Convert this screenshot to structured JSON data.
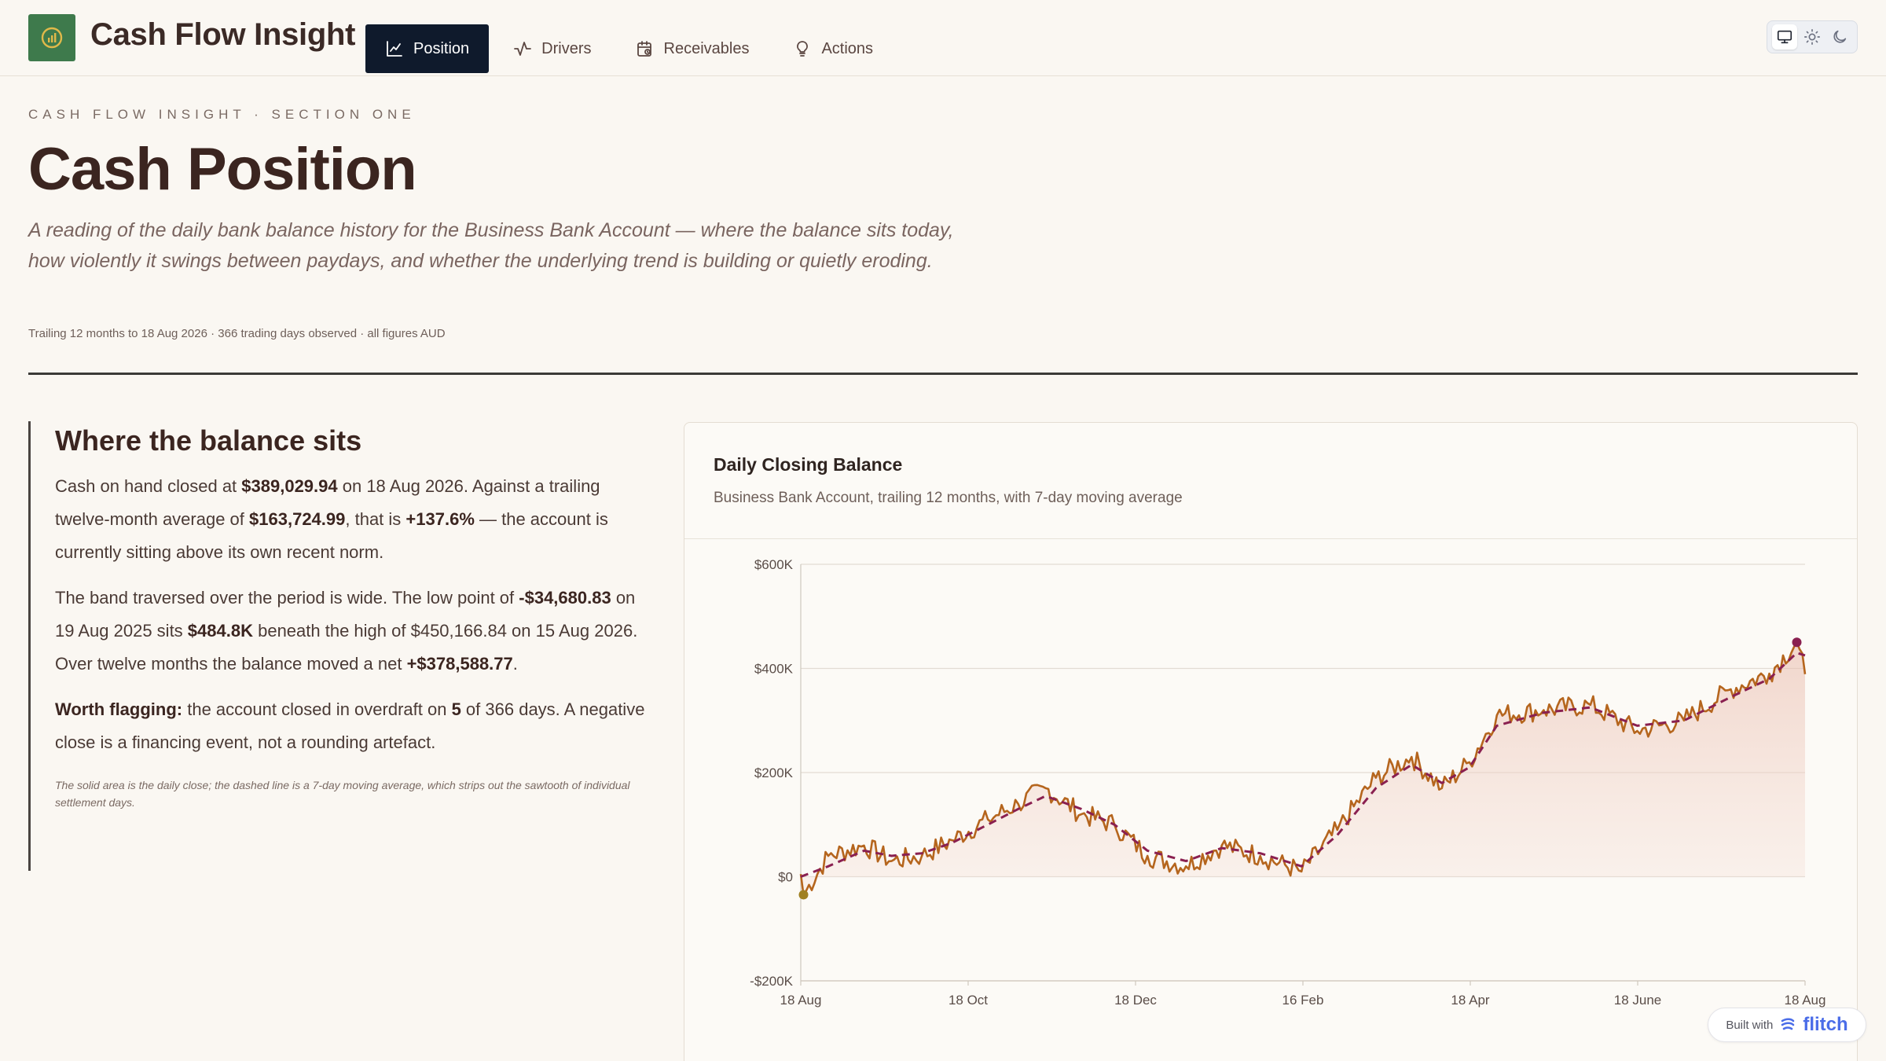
{
  "app": {
    "title": "Cash Flow Insight"
  },
  "nav": [
    {
      "label": "Position",
      "icon": "line-chart-icon",
      "active": true
    },
    {
      "label": "Drivers",
      "icon": "activity-icon",
      "active": false
    },
    {
      "label": "Receivables",
      "icon": "calendar-clock-icon",
      "active": false
    },
    {
      "label": "Actions",
      "icon": "lightbulb-icon",
      "active": false
    }
  ],
  "theme": {
    "options": [
      "monitor-icon",
      "sun-icon",
      "moon-icon"
    ],
    "selected": "monitor-icon"
  },
  "header": {
    "eyebrow": "CASH FLOW INSIGHT · SECTION ONE",
    "title": "Cash Position",
    "lede": "A reading of the daily bank balance history for the Business Bank Account — where the balance sits today, how violently it swings between paydays, and whether the underlying trend is building or quietly eroding.",
    "meta": "Trailing 12 months to 18 Aug 2026 · 366 trading days observed · all figures AUD"
  },
  "narrative": {
    "title": "Where the balance sits",
    "p1": {
      "a": "Cash on hand closed at ",
      "closing": "$389,029.94",
      "b": " on 18 Aug 2026. Against a trailing twelve-month average of ",
      "average": "$163,724.99",
      "c": ", that is ",
      "pct": "+137.6%",
      "d": " — the account is currently sitting above its own recent norm."
    },
    "p2": {
      "a": "The band traversed over the period is wide. The low point of ",
      "low": "-$34,680.83",
      "b": " on 19 Aug 2025 sits ",
      "gap": "$484.8K",
      "c": " beneath the high of $450,166.84 on 15 Aug 2026. Over twelve months the balance moved a net ",
      "net": "+$378,588.77",
      "d": "."
    },
    "p3": {
      "flag": "Worth flagging:",
      "a": " the account closed in overdraft on ",
      "days": "5",
      "b": " of 366 days. A negative close is a financing event, not a rounding artefact."
    },
    "note": "The solid area is the daily close; the dashed line is a 7-day moving average, which strips out the sawtooth of individual settlement days."
  },
  "chart_card": {
    "title": "Daily Closing Balance",
    "subtitle": "Business Bank Account, trailing 12 months, with 7-day moving average"
  },
  "chart_data": {
    "type": "area",
    "title": "Daily Closing Balance",
    "xlabel": "",
    "ylabel": "",
    "x_ticks": [
      "18 Aug",
      "18 Oct",
      "18 Dec",
      "16 Feb",
      "18 Apr",
      "18 June",
      "18 Aug"
    ],
    "y_ticks": [
      "$600K",
      "$400K",
      "$200K",
      "$0",
      "-$200K"
    ],
    "ylim": [
      -200000,
      600000
    ],
    "grid": true,
    "series": [
      {
        "style": "solid-area",
        "color": "#b5651d",
        "points": [
          {
            "x": "2025-08-18",
            "y": 5000
          },
          {
            "x": "2025-08-19",
            "y": -34681
          },
          {
            "x": "2025-08-28",
            "y": 40000
          },
          {
            "x": "2025-09-10",
            "y": 60000
          },
          {
            "x": "2025-09-20",
            "y": 30000
          },
          {
            "x": "2025-10-01",
            "y": 40000
          },
          {
            "x": "2025-10-12",
            "y": 70000
          },
          {
            "x": "2025-10-25",
            "y": 110000
          },
          {
            "x": "2025-11-05",
            "y": 140000
          },
          {
            "x": "2025-11-15",
            "y": 170000
          },
          {
            "x": "2025-11-28",
            "y": 120000
          },
          {
            "x": "2025-12-10",
            "y": 100000
          },
          {
            "x": "2025-12-22",
            "y": 40000
          },
          {
            "x": "2026-01-05",
            "y": 20000
          },
          {
            "x": "2026-01-18",
            "y": 60000
          },
          {
            "x": "2026-02-01",
            "y": 40000
          },
          {
            "x": "2026-02-16",
            "y": 10000
          },
          {
            "x": "2026-03-01",
            "y": 90000
          },
          {
            "x": "2026-03-15",
            "y": 190000
          },
          {
            "x": "2026-03-28",
            "y": 230000
          },
          {
            "x": "2026-04-08",
            "y": 170000
          },
          {
            "x": "2026-04-18",
            "y": 220000
          },
          {
            "x": "2026-04-28",
            "y": 310000
          },
          {
            "x": "2026-05-15",
            "y": 320000
          },
          {
            "x": "2026-06-01",
            "y": 330000
          },
          {
            "x": "2026-06-18",
            "y": 280000
          },
          {
            "x": "2026-07-05",
            "y": 300000
          },
          {
            "x": "2026-07-22",
            "y": 360000
          },
          {
            "x": "2026-08-05",
            "y": 390000
          },
          {
            "x": "2026-08-15",
            "y": 450167
          },
          {
            "x": "2026-08-18",
            "y": 389030
          }
        ]
      },
      {
        "style": "dashed-line",
        "color": "#8a2050",
        "points": [
          {
            "x": "2025-08-18",
            "y": 0
          },
          {
            "x": "2025-08-28",
            "y": 20000
          },
          {
            "x": "2025-09-10",
            "y": 50000
          },
          {
            "x": "2025-09-20",
            "y": 40000
          },
          {
            "x": "2025-10-01",
            "y": 45000
          },
          {
            "x": "2025-10-12",
            "y": 65000
          },
          {
            "x": "2025-10-25",
            "y": 100000
          },
          {
            "x": "2025-11-05",
            "y": 130000
          },
          {
            "x": "2025-11-15",
            "y": 155000
          },
          {
            "x": "2025-11-28",
            "y": 130000
          },
          {
            "x": "2025-12-10",
            "y": 100000
          },
          {
            "x": "2025-12-22",
            "y": 50000
          },
          {
            "x": "2026-01-05",
            "y": 30000
          },
          {
            "x": "2026-01-18",
            "y": 55000
          },
          {
            "x": "2026-02-01",
            "y": 45000
          },
          {
            "x": "2026-02-16",
            "y": 20000
          },
          {
            "x": "2026-03-01",
            "y": 80000
          },
          {
            "x": "2026-03-15",
            "y": 170000
          },
          {
            "x": "2026-03-28",
            "y": 215000
          },
          {
            "x": "2026-04-08",
            "y": 180000
          },
          {
            "x": "2026-04-18",
            "y": 210000
          },
          {
            "x": "2026-04-28",
            "y": 290000
          },
          {
            "x": "2026-05-15",
            "y": 315000
          },
          {
            "x": "2026-06-01",
            "y": 325000
          },
          {
            "x": "2026-06-18",
            "y": 290000
          },
          {
            "x": "2026-07-05",
            "y": 300000
          },
          {
            "x": "2026-07-22",
            "y": 345000
          },
          {
            "x": "2026-08-05",
            "y": 380000
          },
          {
            "x": "2026-08-15",
            "y": 430000
          },
          {
            "x": "2026-08-18",
            "y": 425000
          }
        ]
      }
    ],
    "markers": [
      {
        "x": "2025-08-19",
        "y": -34681,
        "color": "#a08020"
      },
      {
        "x": "2026-08-15",
        "y": 450167,
        "color": "#8a2050"
      }
    ]
  },
  "badge": {
    "prefix": "Built with",
    "brand": "flitch"
  }
}
